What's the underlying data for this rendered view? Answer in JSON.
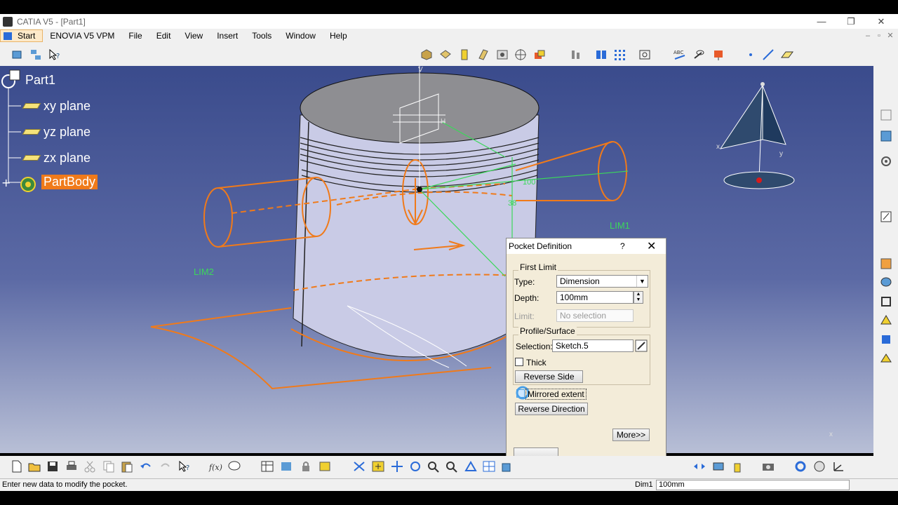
{
  "window": {
    "title": "CATIA V5 - [Part1]",
    "minimize": "—",
    "restore": "❐",
    "close": "✕",
    "mdi_minimize": "–",
    "mdi_restore": "▫",
    "mdi_close": "✕"
  },
  "menu": {
    "start": "Start",
    "items": [
      "ENOVIA V5 VPM",
      "File",
      "Edit",
      "View",
      "Insert",
      "Tools",
      "Window",
      "Help"
    ]
  },
  "tree": {
    "root": "Part1",
    "items": [
      {
        "label": "xy plane"
      },
      {
        "label": "yz plane"
      },
      {
        "label": "zx plane"
      },
      {
        "label": "PartBody"
      }
    ]
  },
  "viewport": {
    "lim1": "LIM1",
    "lim2": "LIM2",
    "dim_label": "38",
    "dim_label2": "100",
    "axis_x": "x",
    "axis_y": "y",
    "axis_v": "V",
    "axis_h": "H",
    "compass_x": "x",
    "compass_y": "y"
  },
  "dialog": {
    "title": "Pocket Definition",
    "help": "?",
    "close": "✕",
    "first_limit": {
      "label": "First Limit",
      "type_label": "Type:",
      "type_value": "Dimension",
      "depth_label": "Depth:",
      "depth_value": "100mm",
      "limit_label": "Limit:",
      "limit_value": "No selection"
    },
    "profile": {
      "label": "Profile/Surface",
      "selection_label": "Selection:",
      "selection_value": "Sketch.5",
      "thick_label": "Thick",
      "reverse_side": "Reverse Side"
    },
    "mirrored_extent": "Mirrored extent",
    "reverse_direction": "Reverse Direction",
    "more": "More>>"
  },
  "status": {
    "message": "Enter new data to modify the pocket.",
    "dim_label": "Dim1",
    "dim_value": "100mm"
  },
  "colors": {
    "accent": "#f07a1a",
    "sketch_green": "#3bd85a",
    "tree_selected": "#f07a1a"
  }
}
